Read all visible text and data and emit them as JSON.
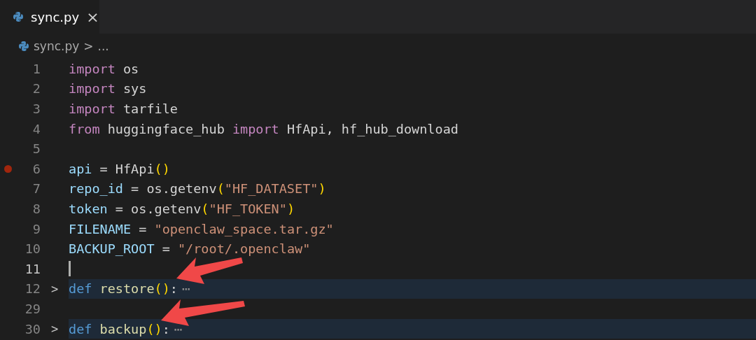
{
  "tabs": [
    {
      "label": "sync.py",
      "close": "×",
      "selected": true
    }
  ],
  "breadcrumb": {
    "file": "sync.py",
    "separator": ">",
    "rest": "..."
  },
  "lines": [
    {
      "number": "1",
      "tokens": [
        {
          "text": "import",
          "kind": "keyword"
        },
        {
          "text": " os",
          "kind": "plain"
        }
      ]
    },
    {
      "number": "2",
      "tokens": [
        {
          "text": "import",
          "kind": "keyword"
        },
        {
          "text": " sys",
          "kind": "plain"
        }
      ]
    },
    {
      "number": "3",
      "tokens": [
        {
          "text": "import",
          "kind": "keyword"
        },
        {
          "text": " tarfile",
          "kind": "plain"
        }
      ]
    },
    {
      "number": "4",
      "tokens": [
        {
          "text": "from",
          "kind": "keyword"
        },
        {
          "text": " huggingface_hub ",
          "kind": "plain"
        },
        {
          "text": "import",
          "kind": "keyword"
        },
        {
          "text": " HfApi, hf_hub_download",
          "kind": "plain"
        }
      ]
    },
    {
      "number": "5"
    },
    {
      "number": "6",
      "breakpoint": true,
      "tokens": [
        {
          "text": "api",
          "kind": "variable"
        },
        {
          "text": " = ",
          "kind": "plain"
        },
        {
          "text": "HfApi",
          "kind": "plain"
        },
        {
          "text": "()",
          "kind": "paren"
        }
      ]
    },
    {
      "number": "7",
      "tokens": [
        {
          "text": "repo_id",
          "kind": "variable"
        },
        {
          "text": " = os.",
          "kind": "plain"
        },
        {
          "text": "getenv",
          "kind": "plain"
        },
        {
          "text": "(",
          "kind": "paren"
        },
        {
          "text": "\"HF_DATASET\"",
          "kind": "string"
        },
        {
          "text": ")",
          "kind": "paren"
        }
      ]
    },
    {
      "number": "8",
      "tokens": [
        {
          "text": "token",
          "kind": "variable"
        },
        {
          "text": " = os.",
          "kind": "plain"
        },
        {
          "text": "getenv",
          "kind": "plain"
        },
        {
          "text": "(",
          "kind": "paren"
        },
        {
          "text": "\"HF_TOKEN\"",
          "kind": "string"
        },
        {
          "text": ")",
          "kind": "paren"
        }
      ]
    },
    {
      "number": "9",
      "tokens": [
        {
          "text": "FILENAME",
          "kind": "variable"
        },
        {
          "text": " = ",
          "kind": "plain"
        },
        {
          "text": "\"openclaw_space.tar.gz\"",
          "kind": "string"
        }
      ]
    },
    {
      "number": "10",
      "tokens": [
        {
          "text": "BACKUP_ROOT",
          "kind": "variable"
        },
        {
          "text": " = ",
          "kind": "plain"
        },
        {
          "text": "\"/root/.openclaw\"",
          "kind": "string"
        }
      ]
    },
    {
      "number": "11",
      "current": true
    },
    {
      "number": "12",
      "folded": true,
      "chevron": ">",
      "ellipsis": "⋯",
      "tokens": [
        {
          "text": "def",
          "kind": "def"
        },
        {
          "text": " restore",
          "kind": "function"
        },
        {
          "text": "()",
          "kind": "paren"
        },
        {
          "text": ":",
          "kind": "plain"
        }
      ]
    },
    {
      "number": "29"
    },
    {
      "number": "30",
      "folded": true,
      "chevron": ">",
      "ellipsis": "⋯",
      "tokens": [
        {
          "text": "def",
          "kind": "def"
        },
        {
          "text": " backup",
          "kind": "function"
        },
        {
          "text": "()",
          "kind": "paren"
        },
        {
          "text": ":",
          "kind": "plain"
        }
      ]
    }
  ],
  "annotations": [
    {
      "kind": "arrow"
    },
    {
      "kind": "arrow"
    }
  ]
}
